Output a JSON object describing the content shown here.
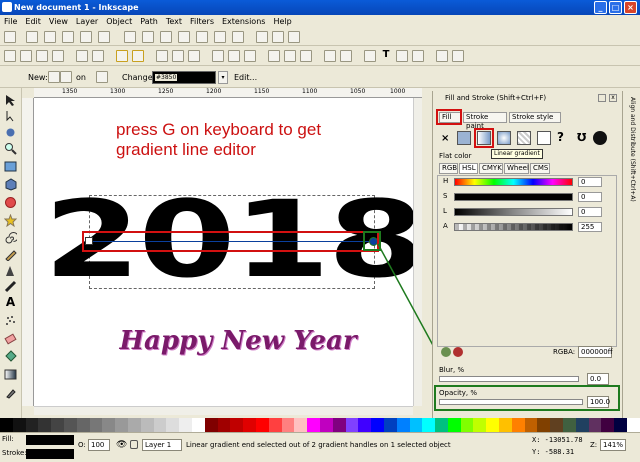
{
  "window": {
    "title": "New document 1 - Inkscape"
  },
  "menu": [
    "File",
    "Edit",
    "View",
    "Layer",
    "Object",
    "Path",
    "Text",
    "Filters",
    "Extensions",
    "Help"
  ],
  "controls": {
    "new_label": "New:",
    "on_label": "on",
    "change_label": "Change:",
    "color_hex": "#3850",
    "edit_label": "Edit..."
  },
  "rulers": {
    "top": [
      "1350",
      "1300",
      "1250",
      "1200",
      "1150",
      "1100",
      "1050",
      "1000"
    ]
  },
  "canvas": {
    "annotation_line1": "press G on keyboard to get",
    "annotation_line2": "gradient line editor",
    "year_text": "2018",
    "greeting_text": "Happy New Year",
    "annotation_color": "#cc1111",
    "greeting_color": "#7a1a6a"
  },
  "panel": {
    "title": "Fill and Stroke (Shift+Ctrl+F)",
    "tabs": [
      "Fill",
      "Stroke paint",
      "Stroke style"
    ],
    "tooltip": "Linear gradient",
    "flat_color_label": "Flat color",
    "color_tabs": [
      "RGB",
      "HSL",
      "CMYK",
      "Wheel",
      "CMS"
    ],
    "sliders": [
      {
        "label": "H",
        "value": "0"
      },
      {
        "label": "S",
        "value": "0"
      },
      {
        "label": "L",
        "value": "0"
      },
      {
        "label": "A",
        "value": "255"
      }
    ],
    "rgba_label": "RGBA:",
    "rgba_value": "000000ff",
    "blur_label": "Blur, %",
    "blur_value": "0.0",
    "opacity_label": "Opacity, %",
    "opacity_value": "100.0",
    "side_strip": "Align and Distribute (Shift+Ctrl+A)"
  },
  "status": {
    "fill_label": "Fill:",
    "stroke_label": "Stroke:",
    "opacity_field_label": "O:",
    "opacity_field_value": "100",
    "layer": "Layer 1",
    "message": "Linear gradient end selected out of 2 gradient handles on 1 selected object",
    "x_coord": "X: -13051.78",
    "y_coord": "Y: -588.31",
    "zoom_label": "Z:",
    "zoom": "141%"
  },
  "colors": {
    "accent_red": "#d21010",
    "accent_green": "#1e7a1e",
    "selection_blue": "#0a3f9c"
  }
}
